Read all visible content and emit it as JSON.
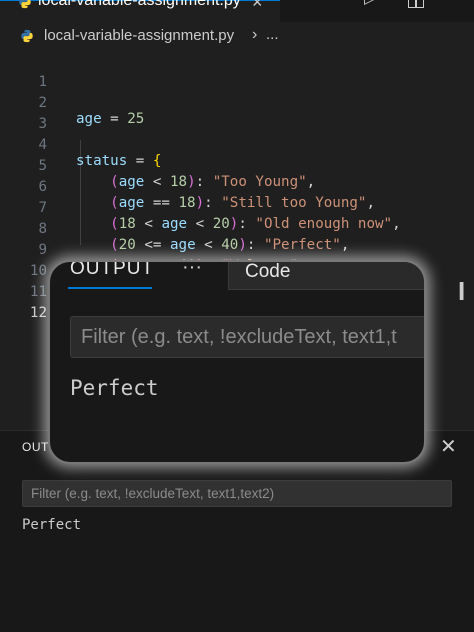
{
  "tab": {
    "title": "local-variable-assignment.py",
    "close": "×"
  },
  "toolbar": {
    "run": "▷",
    "run_dropdown": "⌄",
    "more": "⋯"
  },
  "breadcrumb": {
    "file": "local-variable-assignment.py",
    "separator": "›",
    "more": "..."
  },
  "editor": {
    "line_numbers": [
      "1",
      "2",
      "3",
      "4",
      "5",
      "6",
      "7",
      "8",
      "9",
      "10",
      "11",
      "12"
    ],
    "active_line": "12"
  },
  "panel": {
    "title": "OUTPUT",
    "maximize": "⤢",
    "close": "✕",
    "filter_placeholder": "Filter (e.g. text, !excludeText, text1,text2)",
    "output_text": "Perfect"
  },
  "zoom": {
    "tab_output": "OUTPUT",
    "tab_more": "···",
    "tab_code": "Code",
    "filter_placeholder": "Filter (e.g. text, !excludeText, text1,t",
    "output_text": "Perfect"
  },
  "colors": {
    "accent": "#0078d4",
    "editor_bg": "#1f1f1f",
    "panel_bg": "#181818",
    "string": "#ce9178",
    "number": "#b5cea8",
    "variable": "#9cdcfe",
    "keyword": "#569cd6",
    "bracket_gold": "#ffd700",
    "bracket_purple": "#da70d6"
  },
  "icons": [
    "python-file-icon",
    "close-icon",
    "run-icon",
    "chevron-down-icon",
    "split-editor-icon",
    "more-actions-icon",
    "maximize-panel-icon"
  ]
}
